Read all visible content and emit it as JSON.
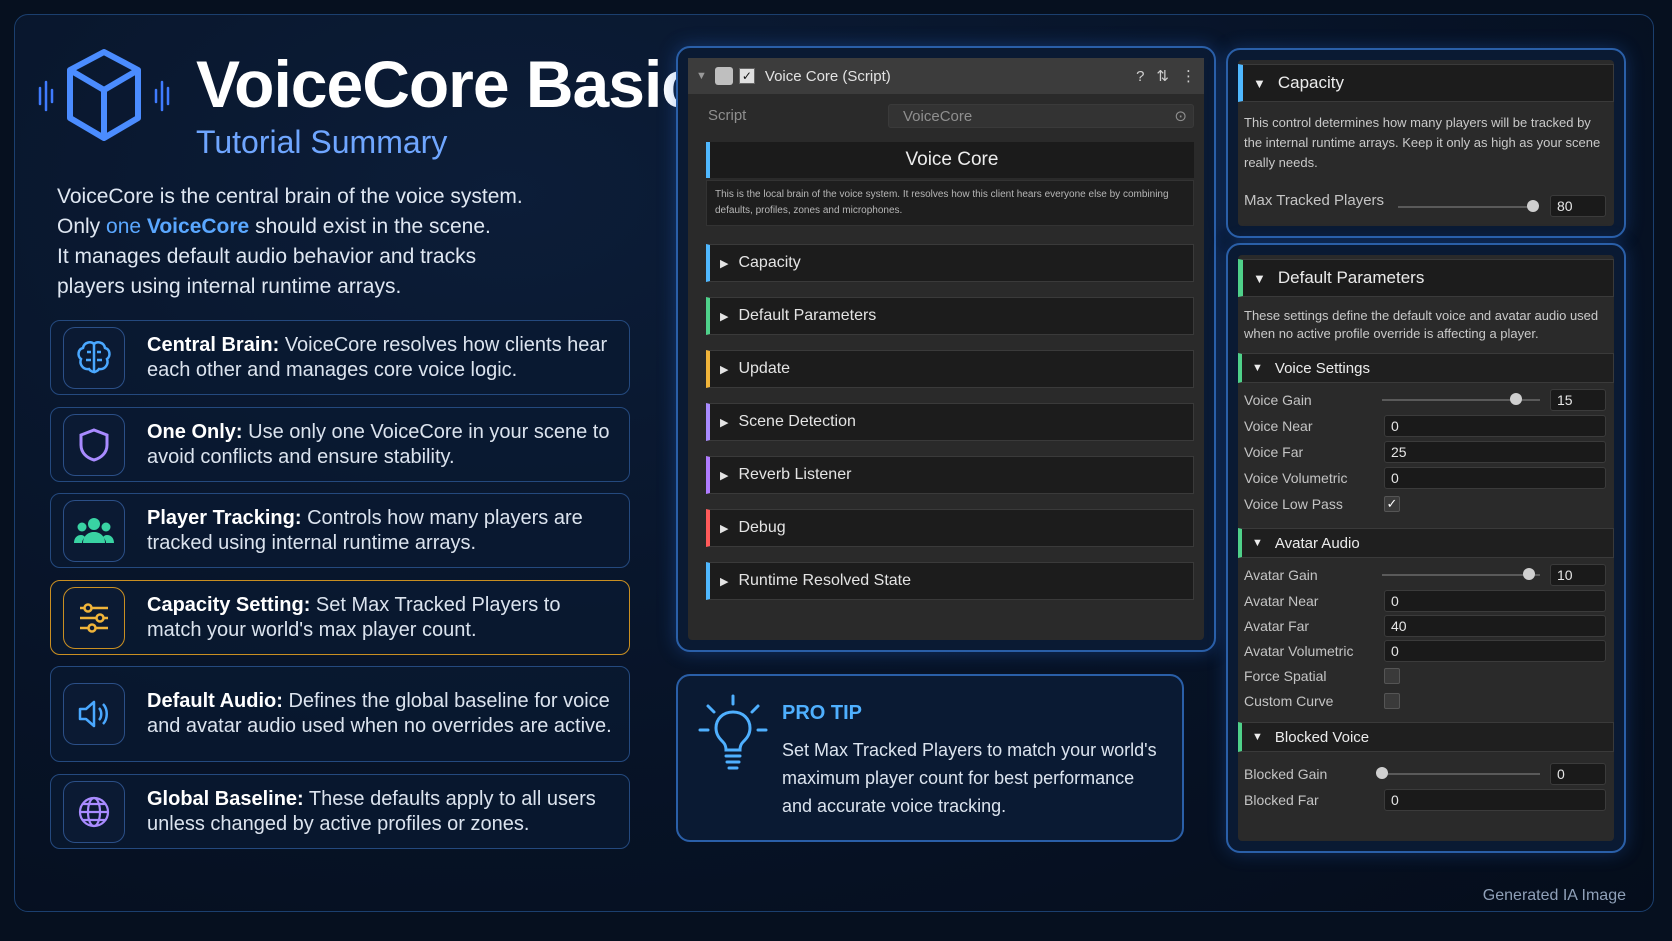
{
  "header": {
    "title": "VoiceCore Basics",
    "subtitle": "Tutorial Summary"
  },
  "intro": {
    "line1": "VoiceCore is the central brain of the voice system.",
    "line2_pre": "Only ",
    "line2_hl1": "one",
    "line2_hl2": "VoiceCore",
    "line2_post": " should exist in the scene.",
    "line3": "It manages default audio behavior and tracks",
    "line4": "players using internal runtime arrays."
  },
  "cards": [
    {
      "title": "Central Brain:",
      "text": "VoiceCore resolves how clients hear each other and manages core voice logic.",
      "icon": "brain-icon",
      "color": "#4aa8ff"
    },
    {
      "title": "One Only:",
      "text": "Use only one VoiceCore in your scene to avoid conflicts and ensure stability.",
      "icon": "shield-icon",
      "color": "#a98bff"
    },
    {
      "title": "Player Tracking:",
      "text": "Controls how many players are tracked using internal runtime arrays.",
      "icon": "users-icon",
      "color": "#39d3a3"
    },
    {
      "title": "Capacity Setting:",
      "text": "Set Max Tracked Players to match your world's max player count.",
      "icon": "sliders-icon",
      "color": "#f0b43a"
    },
    {
      "title": "Default Audio:",
      "text": "Defines the global baseline for voice and avatar audio used when no overrides are active.",
      "icon": "speaker-icon",
      "color": "#4aa8ff"
    },
    {
      "title": "Global Baseline:",
      "text": "These defaults apply to all users unless changed by active profiles or zones.",
      "icon": "globe-icon",
      "color": "#a98bff"
    }
  ],
  "inspector": {
    "component_title": "Voice Core (Script)",
    "script_label": "Script",
    "script_value": "VoiceCore",
    "banner_title": "Voice Core",
    "banner_desc": "This is the local brain of the voice system. It resolves how this client hears everyone else by combining defaults, profiles, zones and microphones.",
    "sections": [
      {
        "label": "Capacity",
        "color": "#4fb8ff"
      },
      {
        "label": "Default Parameters",
        "color": "#4fd18a"
      },
      {
        "label": "Update",
        "color": "#f0b43a"
      },
      {
        "label": "Scene Detection",
        "color": "#a98bff"
      },
      {
        "label": "Reverb Listener",
        "color": "#b07cff"
      },
      {
        "label": "Debug",
        "color": "#ff5a5a"
      },
      {
        "label": "Runtime Resolved State",
        "color": "#4fb8ff"
      }
    ]
  },
  "protip": {
    "title": "PRO TIP",
    "text": "Set Max Tracked Players to match your world's maximum player count for best performance and accurate voice tracking."
  },
  "capacity_panel": {
    "title": "Capacity",
    "desc": "This control determines how many players will be tracked by the internal runtime arrays. Keep it only as high as your scene really needs.",
    "max_label": "Max Tracked Players",
    "max_value": "80",
    "max_fraction": 0.99
  },
  "defaults_panel": {
    "title": "Default Parameters",
    "desc": "These settings define the default voice and avatar audio used when no active profile override is affecting a player.",
    "voice_settings": {
      "title": "Voice Settings",
      "gain_label": "Voice Gain",
      "gain_value": "15",
      "gain_fraction": 0.85,
      "near_label": "Voice Near",
      "near_value": "0",
      "far_label": "Voice Far",
      "far_value": "25",
      "volumetric_label": "Voice Volumetric",
      "volumetric_value": "0",
      "lowpass_label": "Voice Low Pass",
      "lowpass_checked": true
    },
    "avatar_audio": {
      "title": "Avatar Audio",
      "gain_label": "Avatar Gain",
      "gain_value": "10",
      "gain_fraction": 0.93,
      "near_label": "Avatar Near",
      "near_value": "0",
      "far_label": "Avatar Far",
      "far_value": "40",
      "volumetric_label": "Avatar Volumetric",
      "volumetric_value": "0",
      "spatial_label": "Force Spatial",
      "spatial_checked": false,
      "curve_label": "Custom Curve",
      "curve_checked": false
    },
    "blocked_voice": {
      "title": "Blocked Voice",
      "gain_label": "Blocked Gain",
      "gain_value": "0",
      "gain_fraction": 0.0,
      "far_label": "Blocked Far",
      "far_value": "0"
    }
  },
  "footer": "Generated IA Image"
}
